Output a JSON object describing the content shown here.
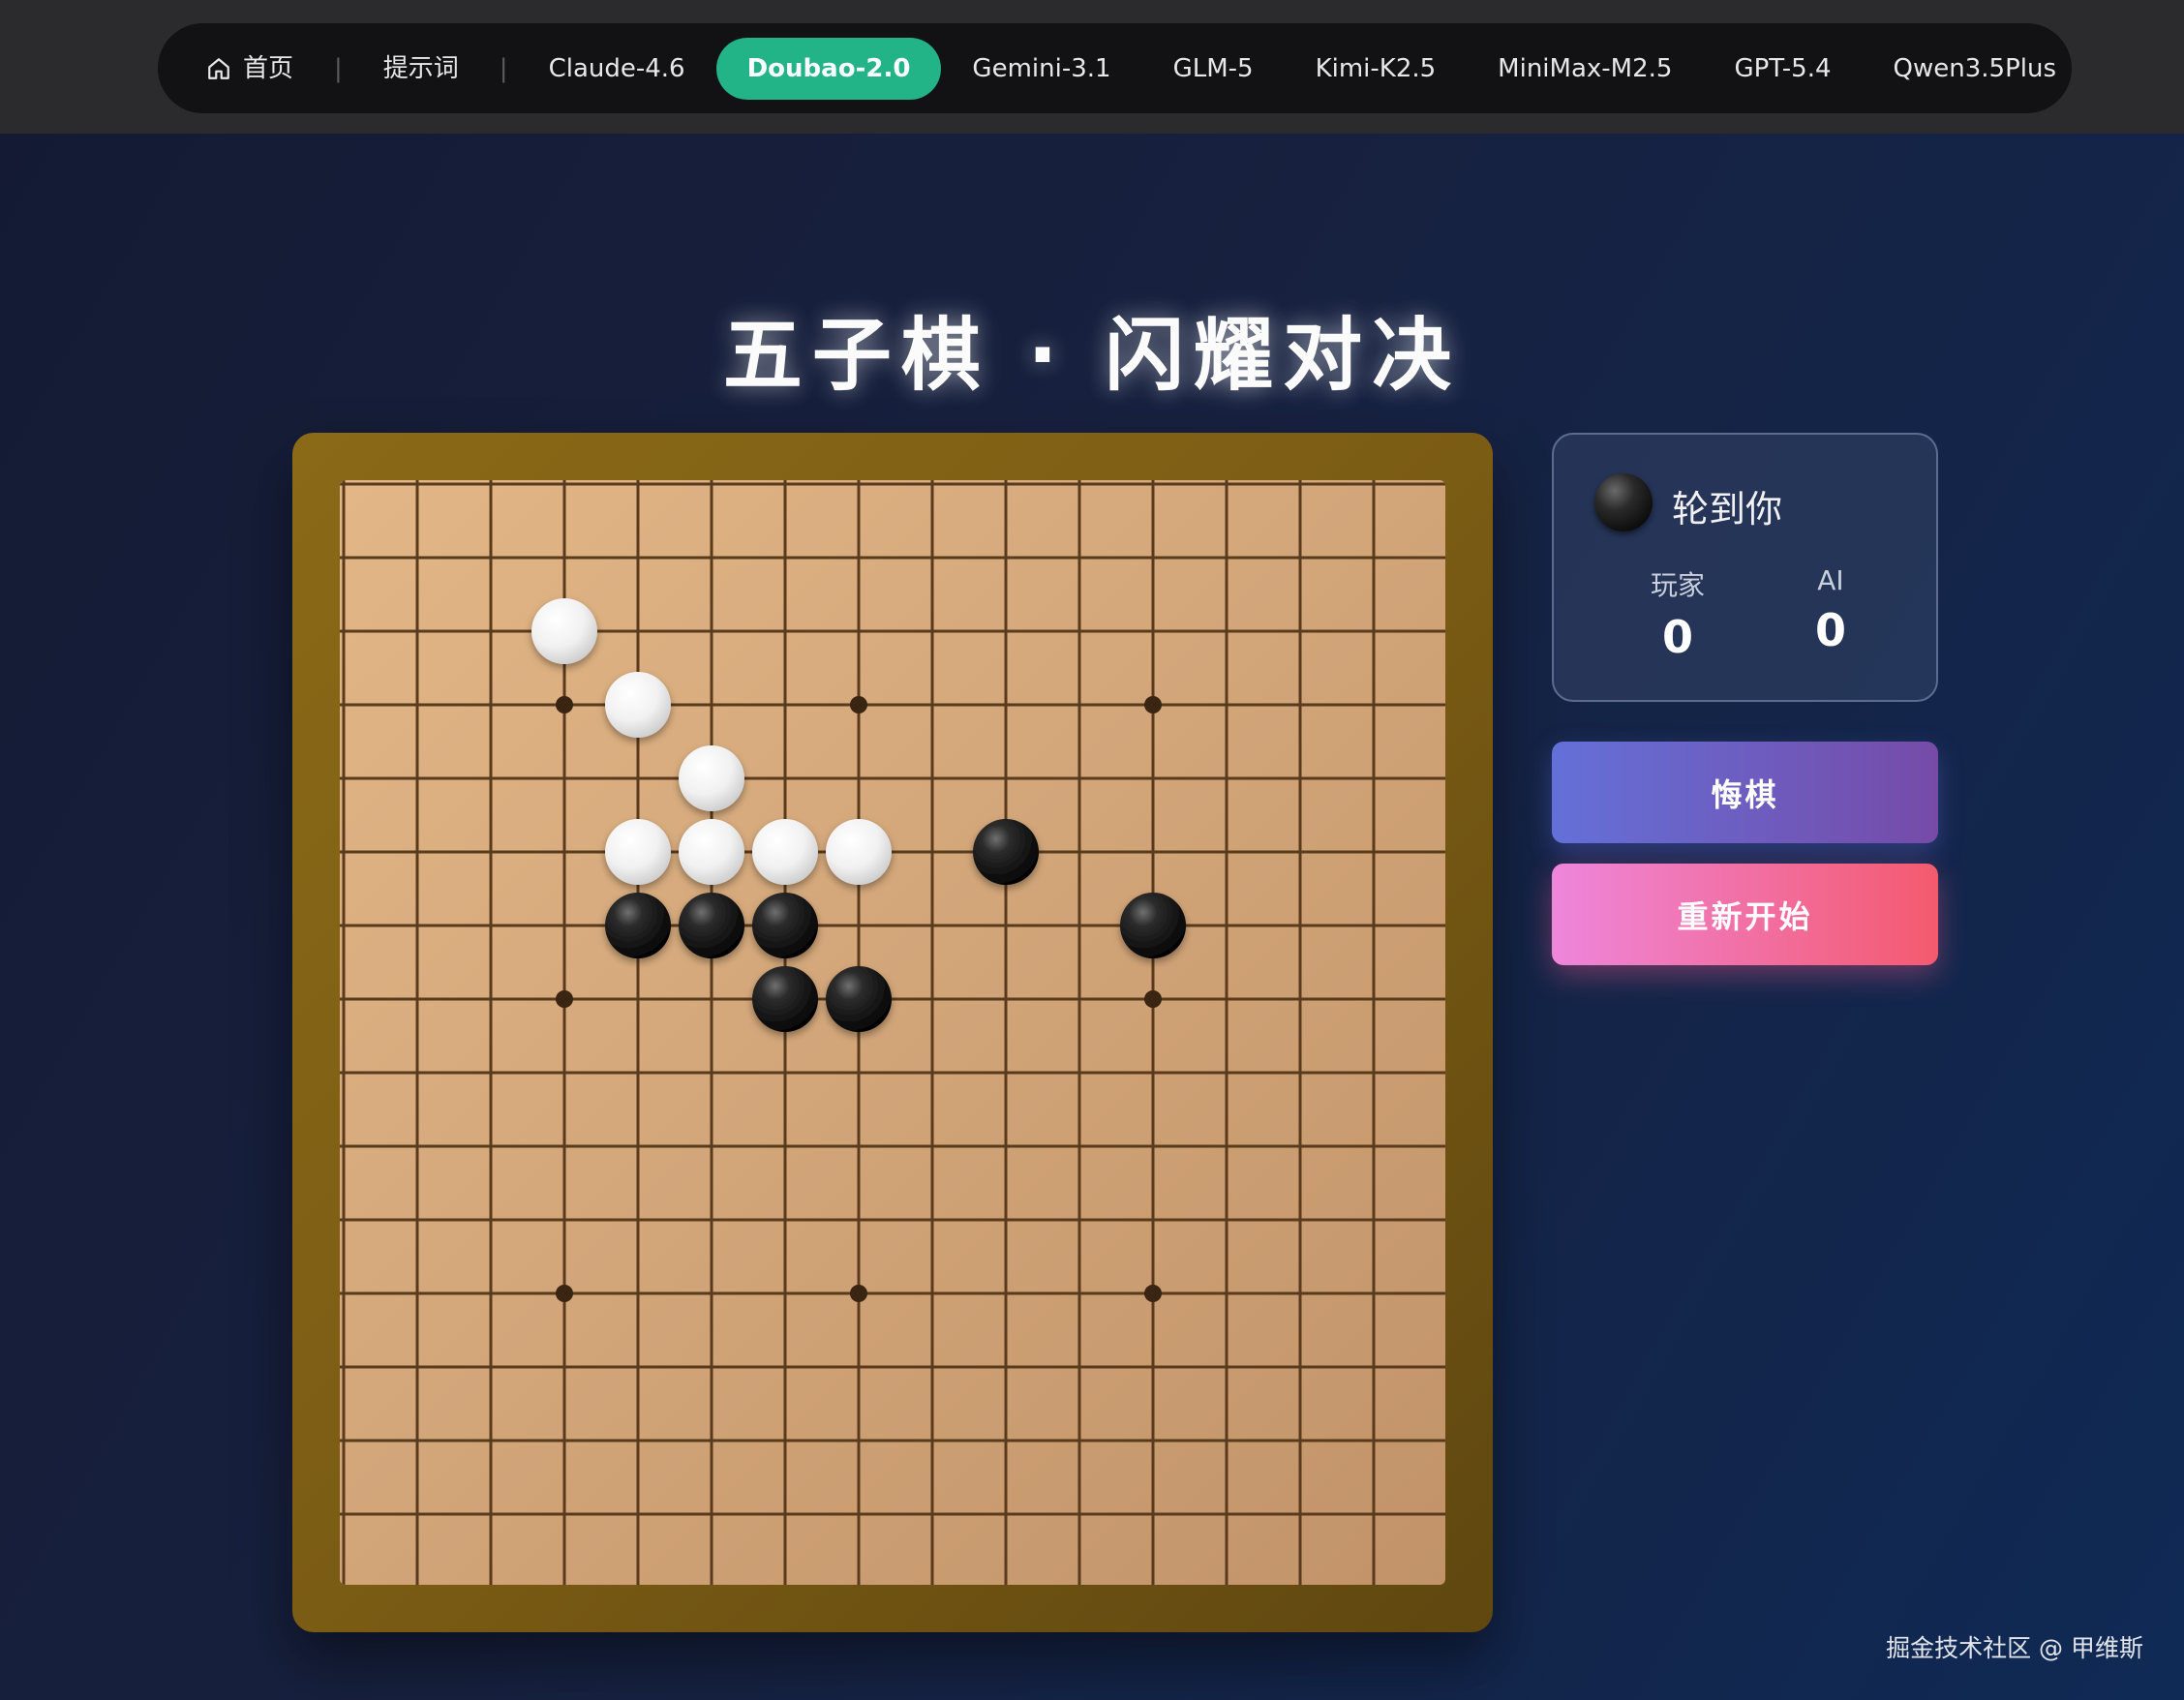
{
  "nav": {
    "items": [
      {
        "label": "首页",
        "icon": "home-icon",
        "active": false
      },
      {
        "label": "提示词",
        "active": false
      },
      {
        "label": "Claude-4.6",
        "active": false
      },
      {
        "label": "Doubao-2.0",
        "active": true
      },
      {
        "label": "Gemini-3.1",
        "active": false
      },
      {
        "label": "GLM-5",
        "active": false
      },
      {
        "label": "Kimi-K2.5",
        "active": false
      },
      {
        "label": "MiniMax-M2.5",
        "active": false
      },
      {
        "label": "GPT-5.4",
        "active": false
      },
      {
        "label": "Qwen3.5Plus",
        "active": false
      }
    ]
  },
  "title": "五子棋 · 闪耀对决",
  "board": {
    "size": 15,
    "star_points": [
      [
        3,
        3
      ],
      [
        3,
        7
      ],
      [
        3,
        11
      ],
      [
        7,
        3
      ],
      [
        7,
        11
      ],
      [
        11,
        3
      ],
      [
        11,
        7
      ],
      [
        11,
        11
      ]
    ],
    "white_stones": [
      [
        2,
        3
      ],
      [
        3,
        4
      ],
      [
        4,
        5
      ],
      [
        5,
        4
      ],
      [
        5,
        5
      ],
      [
        5,
        6
      ],
      [
        5,
        7
      ]
    ],
    "black_stones": [
      [
        5,
        9
      ],
      [
        6,
        4
      ],
      [
        6,
        5
      ],
      [
        6,
        6
      ],
      [
        6,
        11
      ],
      [
        7,
        6
      ],
      [
        7,
        7
      ]
    ]
  },
  "status": {
    "turn_stone": "black",
    "turn_text": "轮到你",
    "player_label": "玩家",
    "player_score": "0",
    "ai_label": "AI",
    "ai_score": "0"
  },
  "buttons": {
    "undo": "悔棋",
    "restart": "重新开始"
  },
  "colors": {
    "active_tab": "#22b386",
    "undo_gradient": [
      "#6470d8",
      "#764ba8"
    ],
    "restart_gradient": [
      "#ee86db",
      "#f45a6e"
    ]
  },
  "credit": "掘金技术社区 @ 甲维斯"
}
